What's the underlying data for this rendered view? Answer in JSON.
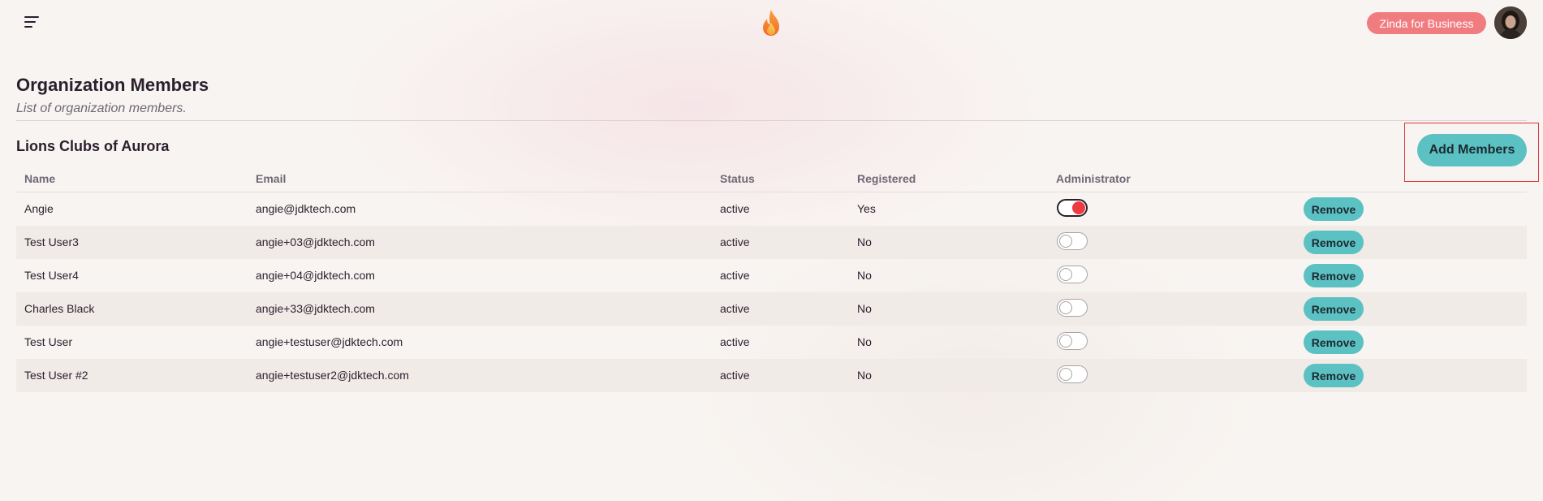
{
  "header": {
    "business_button": "Zinda for Business"
  },
  "page": {
    "title": "Organization Members",
    "subtitle": "List of organization members.",
    "org_name": "Lions Clubs of Aurora",
    "add_members_label": "Add Members"
  },
  "table": {
    "columns": [
      "Name",
      "Email",
      "Status",
      "Registered",
      "Administrator"
    ],
    "remove_label": "Remove",
    "rows": [
      {
        "name": "Angie",
        "email": "angie@jdktech.com",
        "status": "active",
        "registered": "Yes",
        "admin": true
      },
      {
        "name": "Test User3",
        "email": "angie+03@jdktech.com",
        "status": "active",
        "registered": "No",
        "admin": false
      },
      {
        "name": "Test User4",
        "email": "angie+04@jdktech.com",
        "status": "active",
        "registered": "No",
        "admin": false
      },
      {
        "name": "Charles Black",
        "email": "angie+33@jdktech.com",
        "status": "active",
        "registered": "No",
        "admin": false
      },
      {
        "name": "Test User",
        "email": "angie+testuser@jdktech.com",
        "status": "active",
        "registered": "No",
        "admin": false
      },
      {
        "name": "Test User #2",
        "email": "angie+testuser2@jdktech.com",
        "status": "active",
        "registered": "No",
        "admin": false
      }
    ]
  },
  "colors": {
    "accent_teal": "#5cc1c3",
    "business_pink": "#f17c80",
    "toggle_on": "#ef3b3f",
    "highlight_border": "#e0373d"
  },
  "icons": {
    "menu": "hamburger-menu-icon",
    "logo": "flame-logo-icon"
  }
}
